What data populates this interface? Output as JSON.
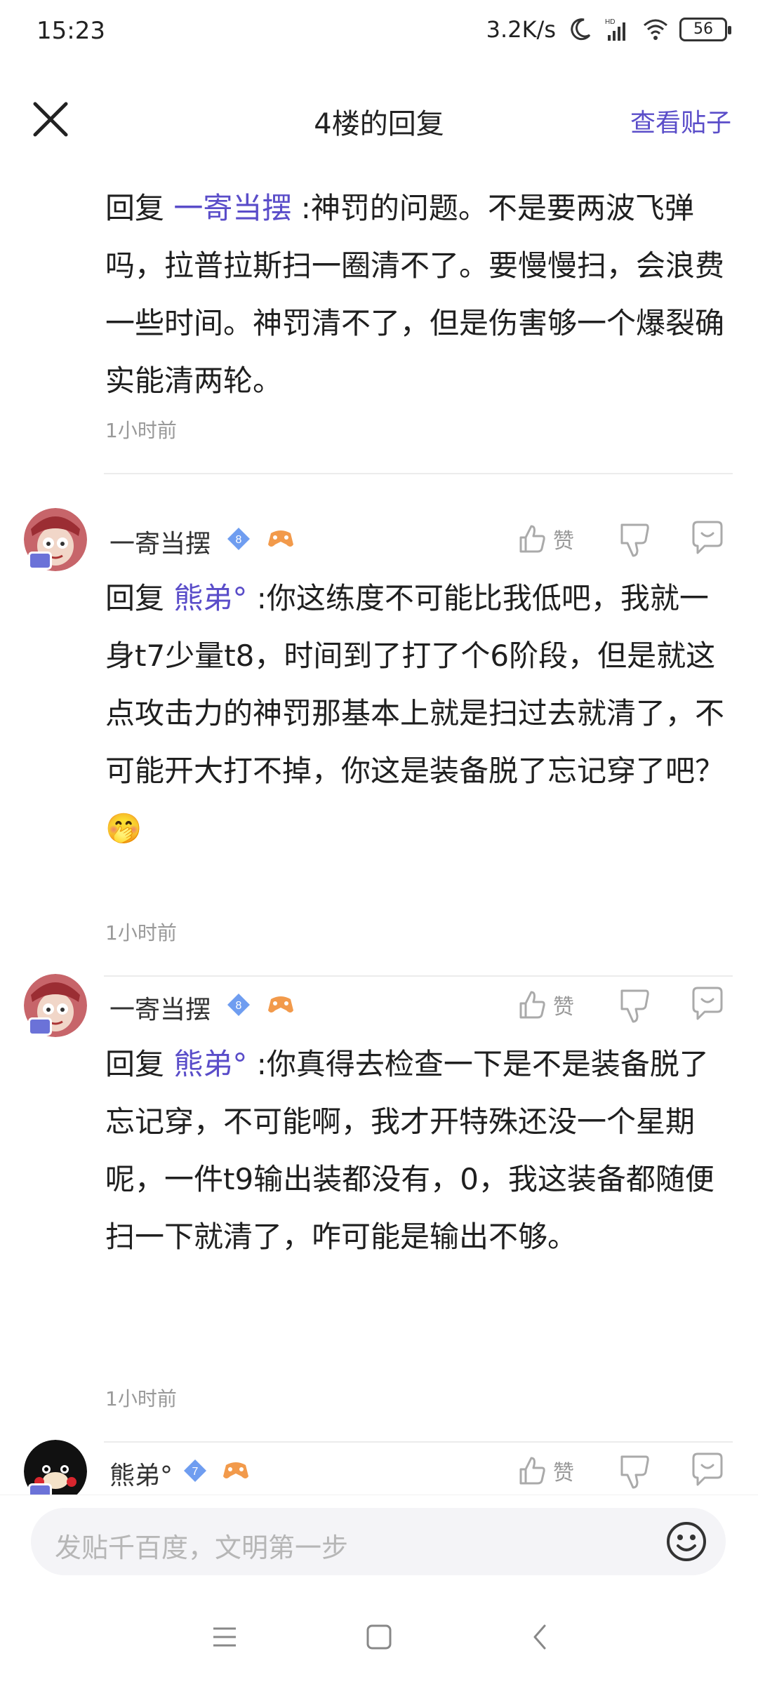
{
  "status": {
    "time": "15:23",
    "speed": "3.2K/s",
    "battery": "56",
    "icons": [
      "moon-icon",
      "signal-hd-icon",
      "wifi-icon",
      "battery-icon"
    ]
  },
  "header": {
    "title": "4楼的回复",
    "view_post": "查看贴子",
    "close_icon": "close-icon"
  },
  "comments": [
    {
      "prefix": "回复 ",
      "target": "一寄当摆",
      "text": " :神罚的问题。不是要两波飞弹吗，拉普拉斯扫一圈清不了。要慢慢扫，会浪费一些时间。神罚清不了，但是伤害够一个爆裂确实能清两轮。",
      "time": "1小时前"
    },
    {
      "user": "一寄当摆",
      "level": "8",
      "like_label": "赞",
      "prefix": "回复 ",
      "target": "熊弟°",
      "text": " :你这练度不可能比我低吧，我就一身t7少量t8，时间到了打了个6阶段，但是就这点攻击力的神罚那基本上就是扫过去就清了，不可能开大打不掉，你这是装备脱了忘记穿了吧？",
      "emoji": "🤭",
      "time": "1小时前"
    },
    {
      "user": "一寄当摆",
      "level": "8",
      "like_label": "赞",
      "prefix": "回复 ",
      "target": "熊弟°",
      "text": " :你真得去检查一下是不是装备脱了忘记穿，不可能啊，我才开特殊还没一个星期呢，一件t9输出装都没有，0，我这装备都随便扫一下就清了，咋可能是输出不够。",
      "time": "1小时前"
    },
    {
      "user": "熊弟°",
      "level": "7",
      "like_label": "赞"
    }
  ],
  "input": {
    "placeholder": "发贴千百度，文明第一步",
    "emoji_icon": "smile-icon"
  },
  "nav": [
    "menu-icon",
    "home-icon",
    "back-icon"
  ],
  "colors": {
    "accent": "#5a4dc9",
    "level_badge": "#6f9df0",
    "muted": "#999999"
  }
}
